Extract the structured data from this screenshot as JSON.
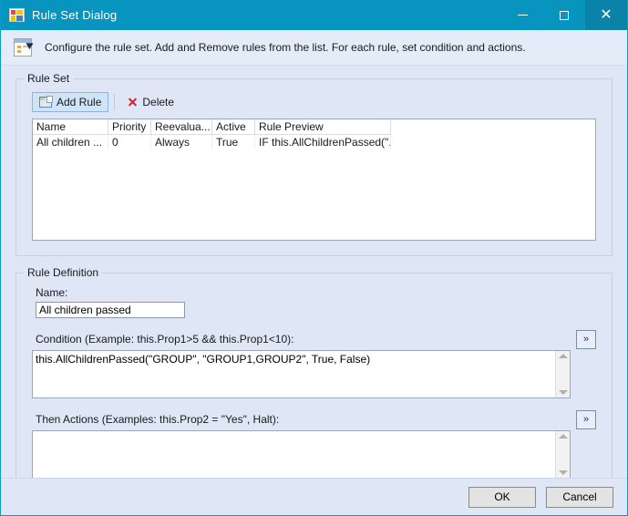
{
  "window": {
    "title": "Rule Set Dialog",
    "icon": "grid-table-icon",
    "controls": {
      "minimize": "minimize-icon",
      "maximize": "maximize-icon",
      "close": "close-icon"
    },
    "accent_color": "#0794be",
    "close_bg_color": "#0b82a8",
    "background_color": "#dfe7f7"
  },
  "header": {
    "icon": "document-edit-icon",
    "description": "Configure the rule set. Add and Remove rules from the list. For each rule, set condition and actions."
  },
  "rule_set": {
    "legend": "Rule Set",
    "toolbar": {
      "add_rule_label": "Add Rule",
      "add_rule_icon": "new-window-icon",
      "delete_label": "Delete",
      "delete_icon": "close-x-icon"
    },
    "columns": [
      "Name",
      "Priority",
      "Reevalua...",
      "Active",
      "Rule Preview"
    ],
    "rows": [
      {
        "name": "All children ...",
        "priority": "0",
        "reevaluation": "Always",
        "active": "True",
        "preview": "IF this.AllChildrenPassed(\"..."
      }
    ]
  },
  "rule_definition": {
    "legend": "Rule Definition",
    "name_label": "Name:",
    "name_value": "All children passed",
    "name_placeholder": "",
    "condition_label": "Condition (Example: this.Prop1>5 && this.Prop1<10):",
    "condition_value": "this.AllChildrenPassed(\"GROUP\", \"GROUP1,GROUP2\", True, False)",
    "condition_placeholder": "",
    "condition_expand_label": "»",
    "actions_label": "Then Actions (Examples: this.Prop2 = \"Yes\", Halt):",
    "actions_value": "",
    "actions_placeholder": "",
    "actions_expand_label": "»",
    "scroll_up_icon": "chevron-up-icon",
    "scroll_down_icon": "chevron-down-icon"
  },
  "footer": {
    "ok_label": "OK",
    "cancel_label": "Cancel"
  }
}
